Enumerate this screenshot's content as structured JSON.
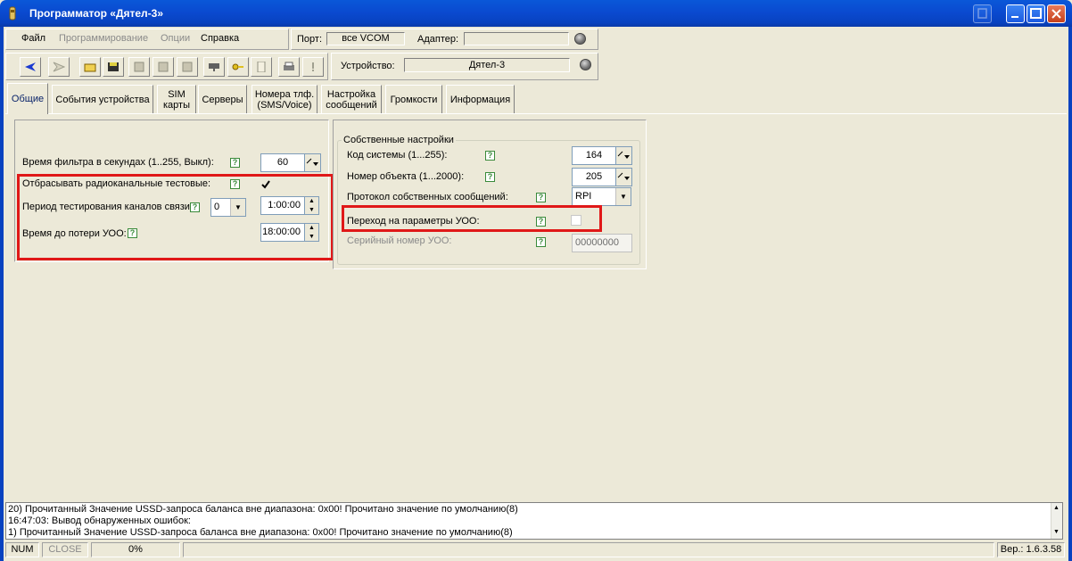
{
  "window": {
    "title": "Программатор «Дятел-3»"
  },
  "menu": {
    "items": [
      {
        "label": "Файл",
        "enabled": true
      },
      {
        "label": "Программирование",
        "enabled": false
      },
      {
        "label": "Опции",
        "enabled": false
      },
      {
        "label": "Справка",
        "enabled": true
      }
    ],
    "port_label": "Порт:",
    "port_value": "все VCOM",
    "adapter_label": "Адаптер:",
    "adapter_value": ""
  },
  "toolbar": {
    "icons": [
      "back-arrow-icon",
      "forward-arrow-icon",
      "open-folder-icon",
      "save-disk-icon",
      "read-device-icon",
      "write-device-icon",
      "verify-device-icon",
      "keyboard-icon",
      "key-icon",
      "notes-icon",
      "print-icon",
      "info-icon"
    ],
    "device_label": "Устройство:",
    "device_value": "Дятел-3"
  },
  "tabs": [
    {
      "label": "Общие",
      "active": true
    },
    {
      "label": "События устройства",
      "active": false
    },
    {
      "label": "SIM\nкарты",
      "active": false
    },
    {
      "label": "Серверы",
      "active": false
    },
    {
      "label": "Номера тлф.\n(SMS/Voice)",
      "active": false
    },
    {
      "label": "Настройка\nсообщений",
      "active": false
    },
    {
      "label": "Громкости",
      "active": false
    },
    {
      "label": "Информация",
      "active": false
    }
  ],
  "left_panel": {
    "filter_time_label": "Время фильтра в секундах (1..255, Выкл):",
    "filter_time_value": "60",
    "drop_radio_tests_label": "Отбрасывать радиоканальные тестовые:",
    "drop_radio_tests_checked": true,
    "test_period_label": "Период тестирования каналов связи",
    "test_period_select": "0",
    "test_period_time": "1:00:00",
    "uoo_loss_time_label": "Время до потери УОО:",
    "uoo_loss_time_value": "18:00:00"
  },
  "right_panel": {
    "group_title": "Собственные настройки",
    "system_code_label": "Код системы (1...255):",
    "system_code_value": "164",
    "object_number_label": "Номер объекта (1...2000):",
    "object_number_value": "205",
    "own_protocol_label": "Протокол собственных сообщений:",
    "own_protocol_value": "RPI",
    "switch_to_uoo_label": "Переход на параметры УОО:",
    "switch_to_uoo_checked": false,
    "uoo_serial_label": "Серийный номер УОО:",
    "uoo_serial_value": "00000000"
  },
  "log": {
    "lines": [
      "20) Прочитанный Значение USSD-запроса баланса вне диапазона: 0x00! Прочитано значение по умолчанию(8)",
      "16:47:03: Вывод обнаруженных ошибок:",
      "1) Прочитанный Значение USSD-запроса баланса вне диапазона: 0x00! Прочитано значение по умолчанию(8)"
    ]
  },
  "statusbar": {
    "num": "NUM",
    "close": "CLOSE",
    "progress": "0%",
    "version": "Вер.: 1.6.3.58"
  },
  "colors": {
    "titlebar": "#0a4ad0",
    "highlight_box": "#e01818",
    "help_icon": "#3a8a3a"
  }
}
